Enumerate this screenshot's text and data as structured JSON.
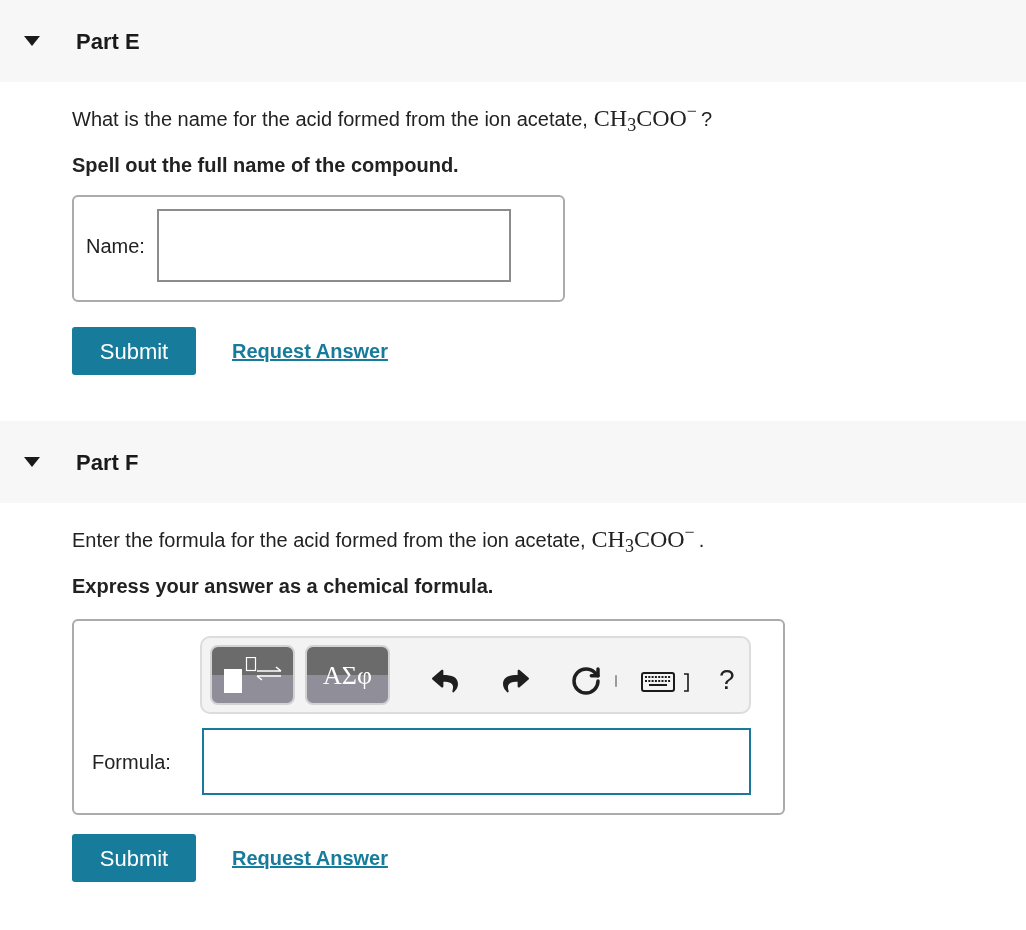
{
  "parts": [
    {
      "title": "Part E",
      "expanded": true,
      "question": {
        "before": "What is the name for the acid formed from the ion acetate,",
        "formula": "CH$_{3}$COO$^{−}$",
        "after": "?"
      },
      "instruction": "Spell out the full name of the compound.",
      "answer": {
        "kind": "text",
        "label": "Name:",
        "focused": false
      },
      "submit": "Submit",
      "request_answer": "Request Answer"
    },
    {
      "title": "Part F",
      "expanded": true,
      "question": {
        "before": "Enter the formula for the acid formed from the ion acetate,",
        "formula": "CH$_{3}$COO$^{−}$",
        "after": "."
      },
      "instruction": "Express your answer as a chemical formula.",
      "answer": {
        "kind": "formula",
        "toolbar": {
          "symbols_button": "ΑΣφ",
          "help_button": "?"
        },
        "label": "Formula:",
        "focused": true
      },
      "submit": "Submit",
      "request_answer": "Request Answer"
    }
  ]
}
